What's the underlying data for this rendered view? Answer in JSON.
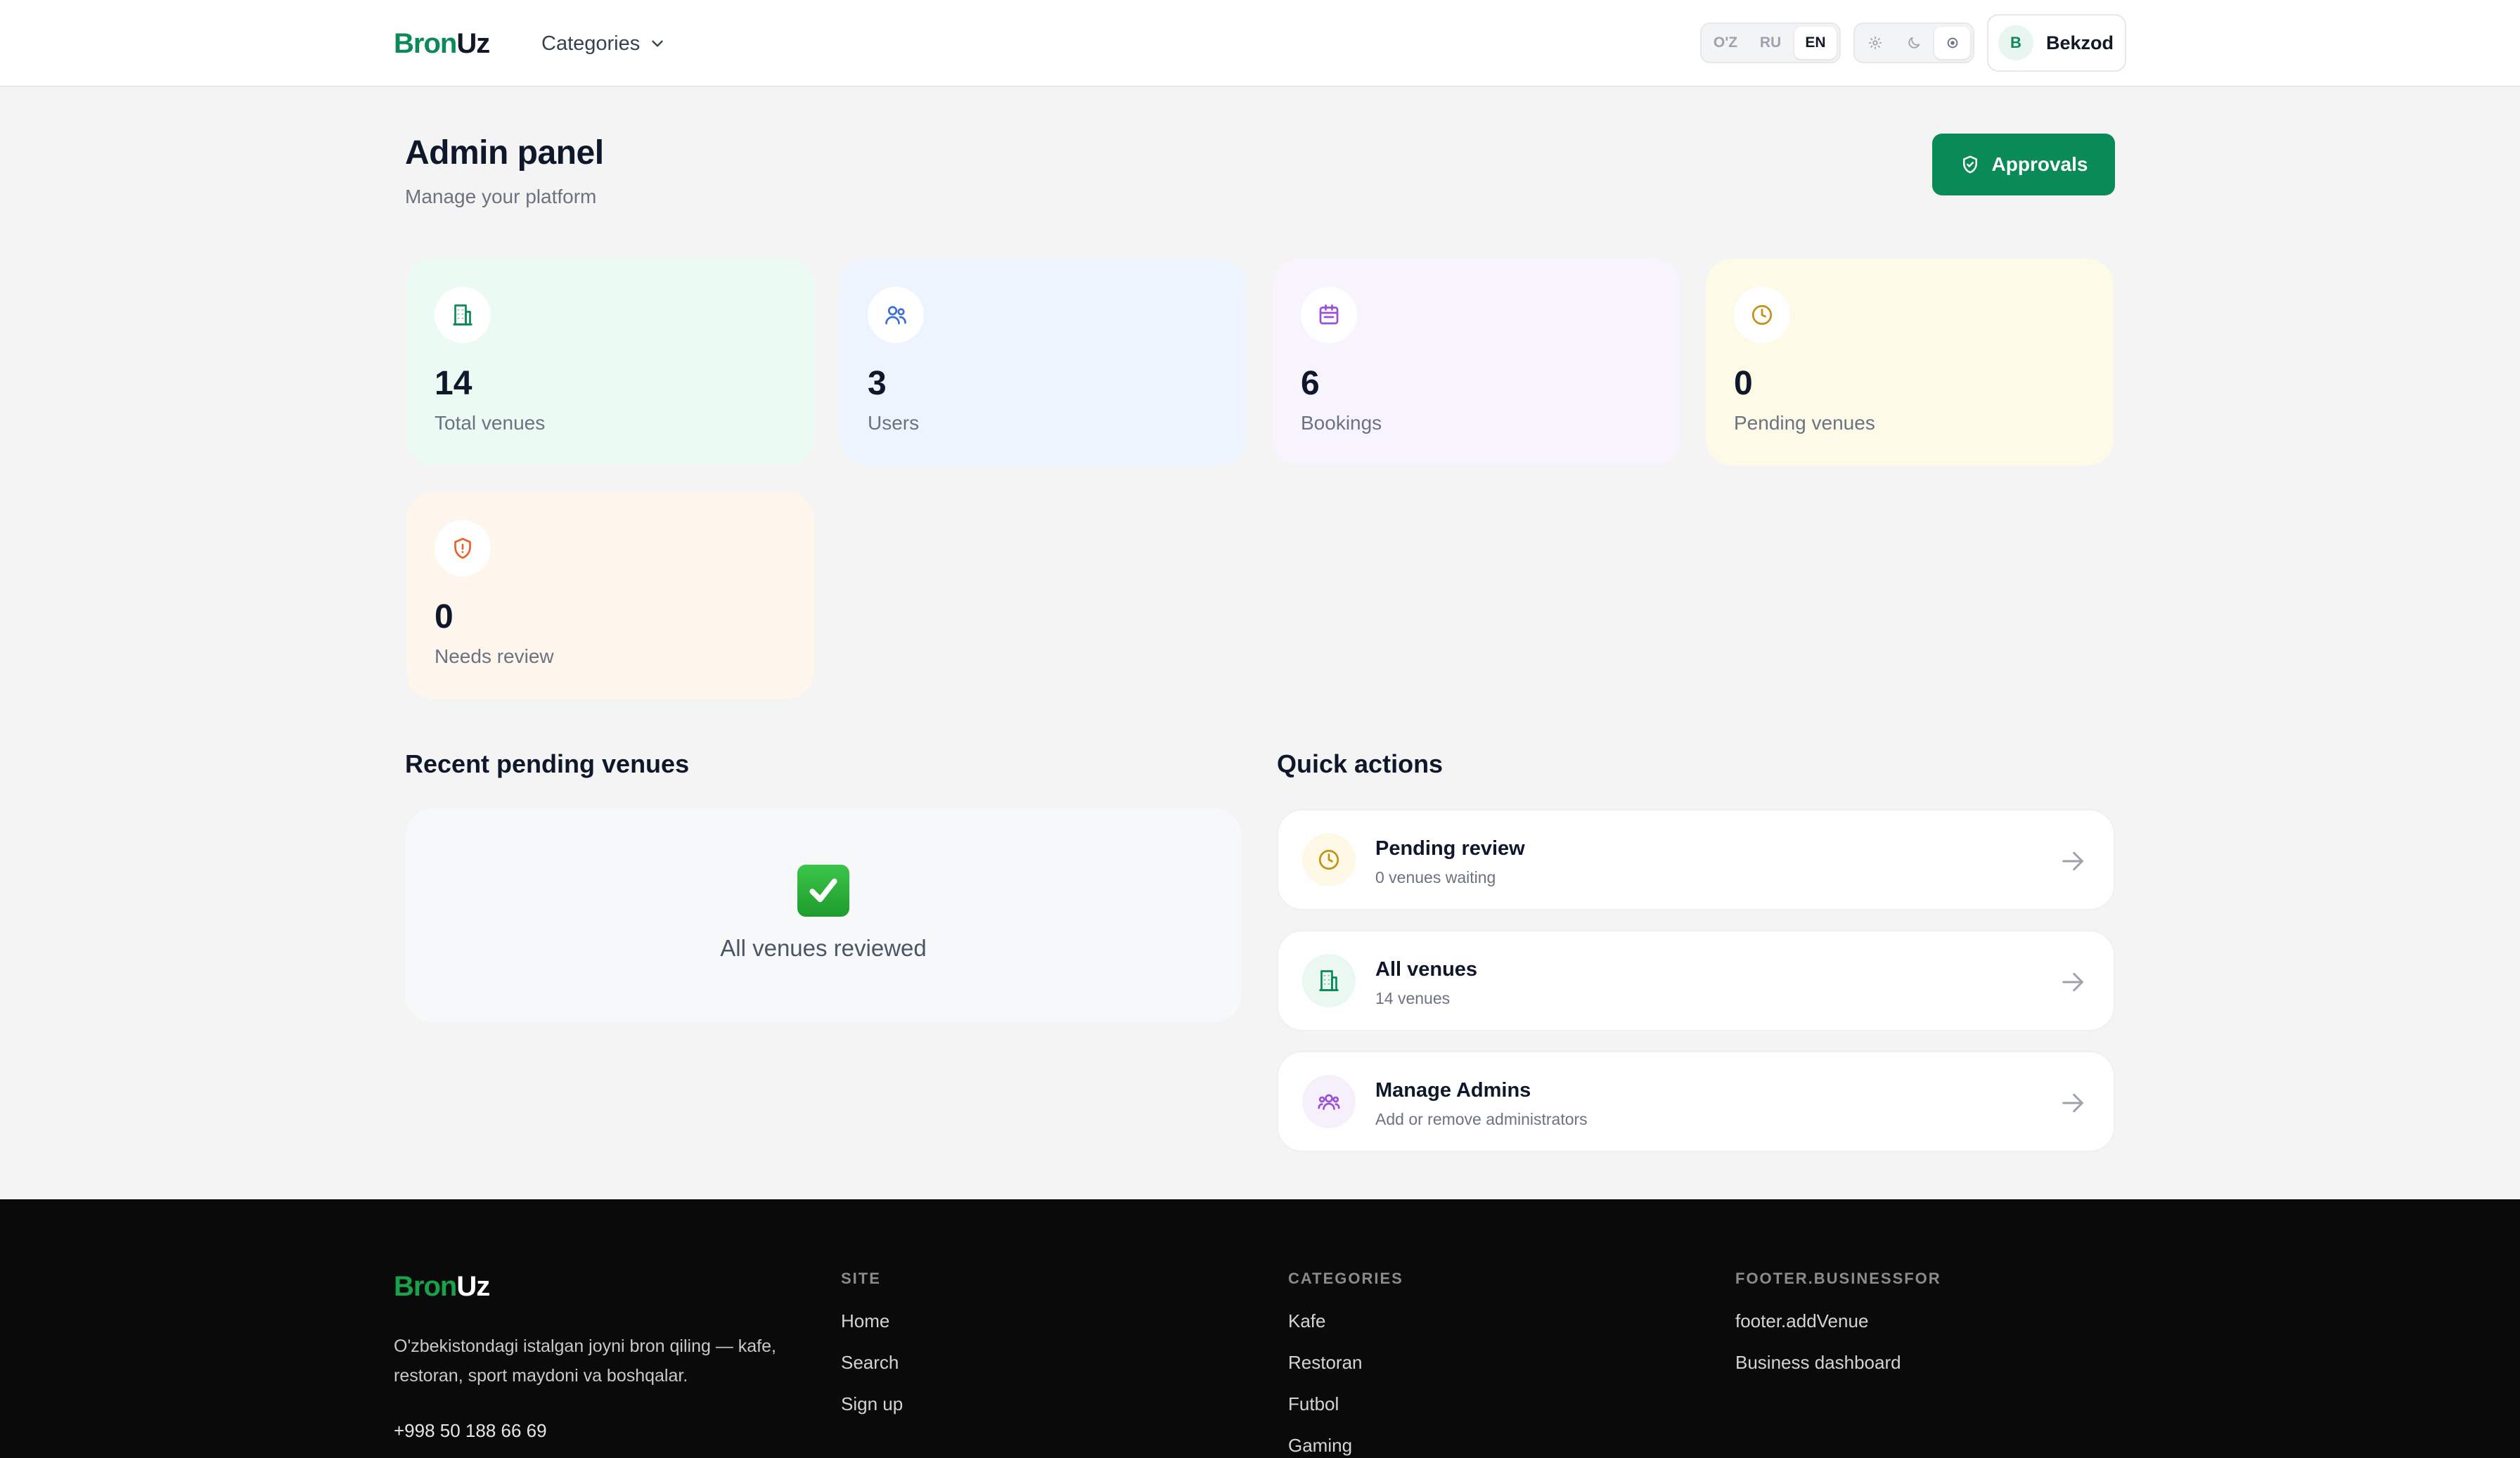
{
  "header": {
    "logo_part1": "Bron",
    "logo_part2": "Uz",
    "categories_label": "Categories",
    "languages": [
      "O'Z",
      "RU",
      "EN"
    ],
    "active_language": "EN",
    "theme_icons": [
      "sun-icon",
      "moon-icon",
      "monitor-icon"
    ],
    "active_theme": "monitor-icon",
    "user_initial": "B",
    "user_name": "Bekzod"
  },
  "page": {
    "title": "Admin panel",
    "subtitle": "Manage your platform",
    "approvals_label": "Approvals"
  },
  "stats": [
    {
      "value": "14",
      "label": "Total venues",
      "icon": "building-icon",
      "bg": "#ebfaf3",
      "color": "#0a8a57"
    },
    {
      "value": "3",
      "label": "Users",
      "icon": "users-icon",
      "bg": "#eef4fe",
      "color": "#3b6fd8"
    },
    {
      "value": "6",
      "label": "Bookings",
      "icon": "calendar-icon",
      "bg": "#f8f4fd",
      "color": "#9b4fd6"
    },
    {
      "value": "0",
      "label": "Pending venues",
      "icon": "clock-icon",
      "bg": "#fdfbe8",
      "color": "#c49314"
    },
    {
      "value": "0",
      "label": "Needs review",
      "icon": "shield-alert-icon",
      "bg": "#fef5ec",
      "color": "#e8632a"
    }
  ],
  "recent": {
    "title": "Recent pending venues",
    "empty_text": "All venues reviewed"
  },
  "quick_actions": {
    "title": "Quick actions",
    "items": [
      {
        "title": "Pending review",
        "subtitle": "0 venues waiting",
        "icon": "clock-icon",
        "bg": "#fdf9e6",
        "color": "#c49314"
      },
      {
        "title": "All venues",
        "subtitle": "14 venues",
        "icon": "building-icon",
        "bg": "#eaf8f1",
        "color": "#0a8a57"
      },
      {
        "title": "Manage Admins",
        "subtitle": "Add or remove administrators",
        "icon": "users-group-icon",
        "bg": "#f6f0fd",
        "color": "#9b4fd6"
      }
    ]
  },
  "footer": {
    "logo_part1": "Bron",
    "logo_part2": "Uz",
    "description": "O'zbekistondagi istalgan joyni bron qiling — kafe, restoran, sport maydoni va boshqalar.",
    "phone": "+998 50 188 66 69",
    "columns": [
      {
        "title": "SITE",
        "links": [
          "Home",
          "Search",
          "Sign up"
        ]
      },
      {
        "title": "CATEGORIES",
        "links": [
          "Kafe",
          "Restoran",
          "Futbol",
          "Gaming"
        ]
      },
      {
        "title": "FOOTER.BUSINESSFOR",
        "links": [
          "footer.addVenue",
          "Business dashboard"
        ]
      }
    ]
  }
}
